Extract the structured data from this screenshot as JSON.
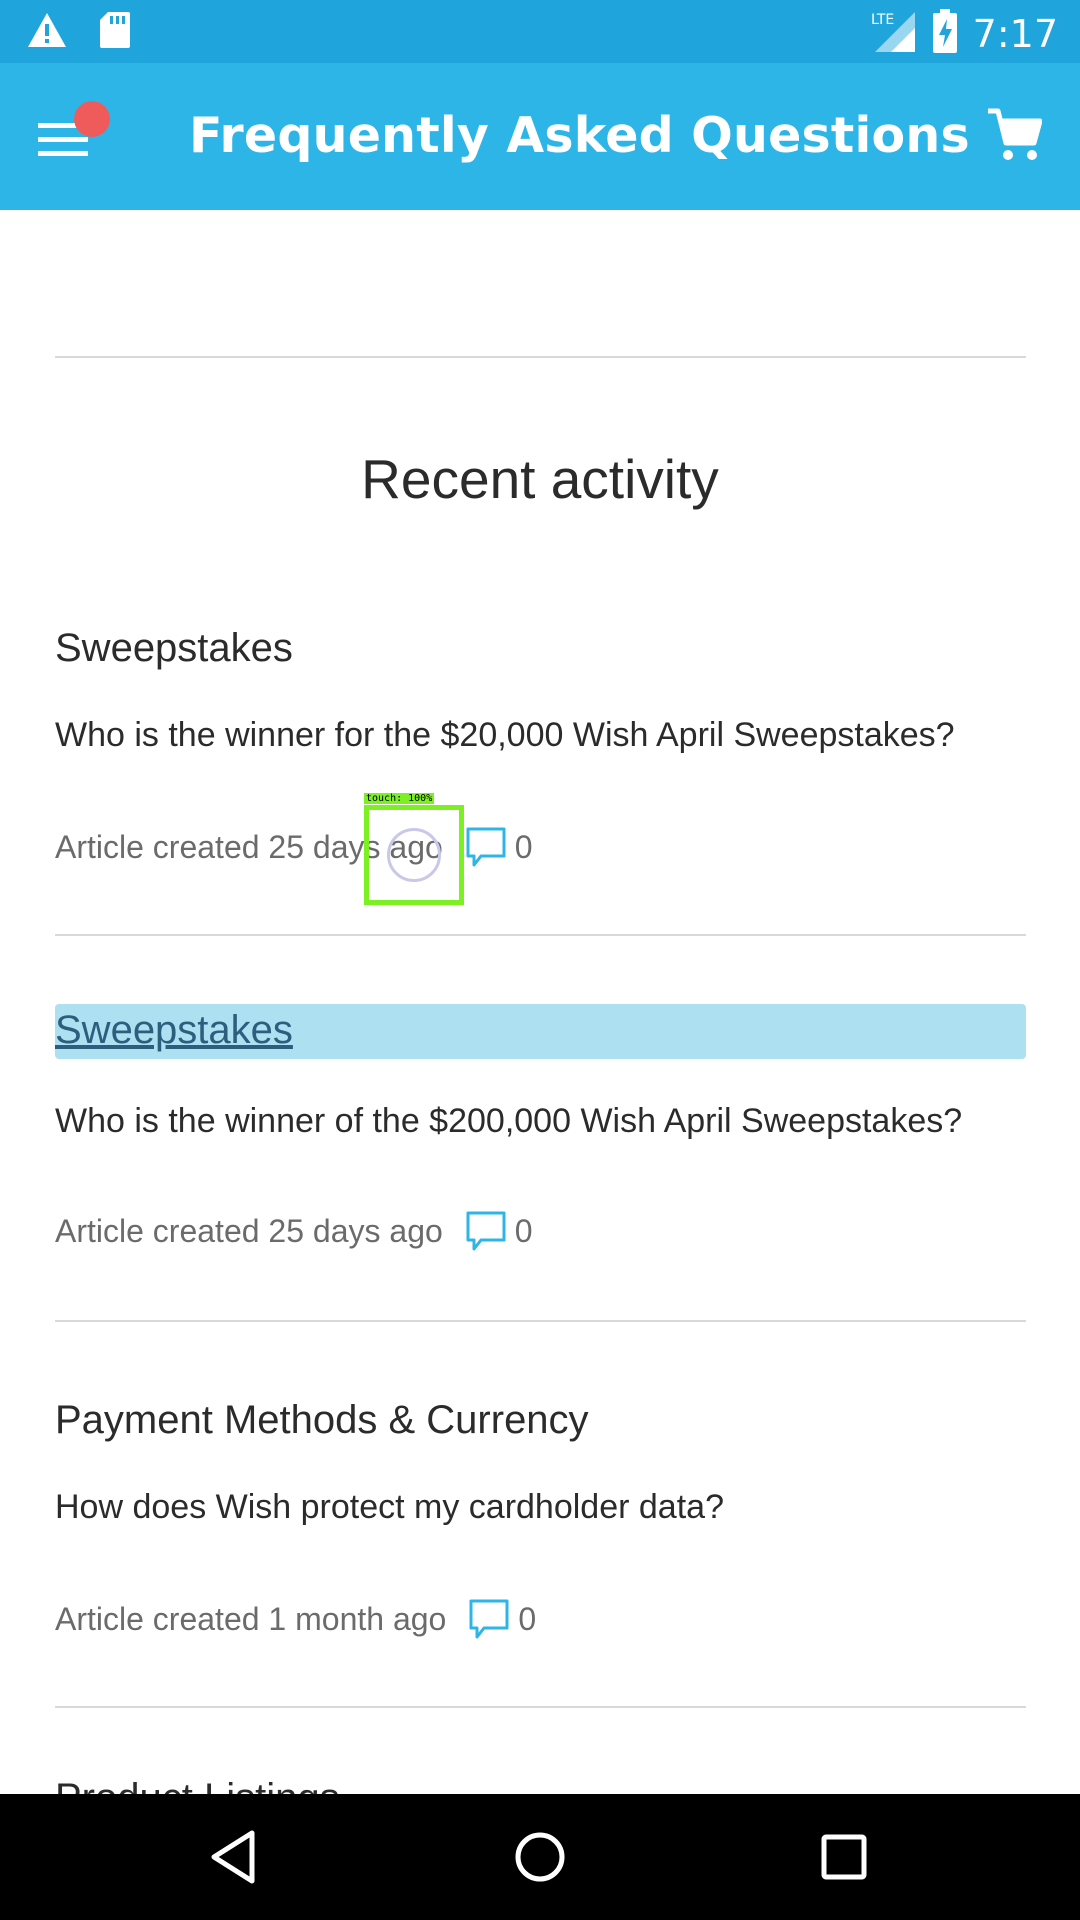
{
  "status_bar": {
    "time": "7:17",
    "network": "LTE",
    "icons": [
      "warning-icon",
      "sd-card-icon",
      "signal-icon",
      "battery-charging-icon"
    ]
  },
  "app_bar": {
    "title": "Frequently Asked Questions",
    "menu_icon": "hamburger-menu-icon",
    "cart_icon": "cart-icon",
    "notification_dot_color": "#ef5b5b"
  },
  "main": {
    "section_title": "Recent activity",
    "items": [
      {
        "category": "Sweepstakes",
        "question": "Who is the winner for the $20,000 Wish April Sweepstakes?",
        "meta": "Article created 25 days ago",
        "comments": "0",
        "highlighted": false
      },
      {
        "category": "Sweepstakes",
        "question": "Who is the winner of the $200,000 Wish April Sweepstakes?",
        "meta": "Article created 25 days ago",
        "comments": "0",
        "highlighted": true
      },
      {
        "category": "Payment Methods & Currency",
        "question": "How does Wish protect my cardholder data?",
        "meta": "Article created 1 month ago",
        "comments": "0",
        "highlighted": false
      }
    ],
    "partial_next_category": "Product Listings"
  },
  "touch_overlay": {
    "label": "touch: 100%"
  },
  "nav_bar": {
    "icons": [
      "back-icon",
      "home-icon",
      "recents-icon"
    ]
  },
  "colors": {
    "status_bar": "#1fa4dc",
    "app_bar": "#2eb5e8",
    "accent": "#2eb5e8",
    "highlight": "#ade0f0"
  }
}
